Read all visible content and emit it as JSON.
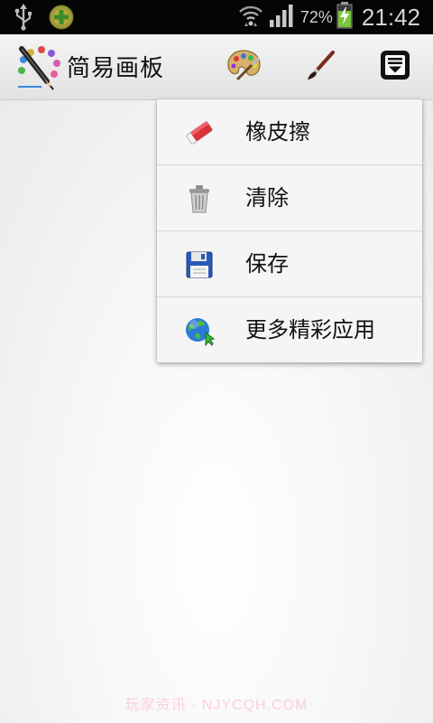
{
  "status_bar": {
    "battery_percent": "72%",
    "time": "21:42",
    "icons": [
      "usb-icon",
      "app-notification-icon",
      "wifi-icon",
      "signal-icon",
      "battery-charging-icon"
    ]
  },
  "action_bar": {
    "title": "简易画板",
    "icons": [
      "app-logo-icon",
      "palette-icon",
      "brush-icon",
      "overflow-menu-icon"
    ]
  },
  "menu": {
    "items": [
      {
        "label": "橡皮擦",
        "icon": "eraser-icon"
      },
      {
        "label": "清除",
        "icon": "trash-icon"
      },
      {
        "label": "保存",
        "icon": "floppy-disk-icon"
      },
      {
        "label": "更多精彩应用",
        "icon": "globe-icon"
      }
    ]
  },
  "watermark": "玩家资讯 · NJYCQH.COM"
}
